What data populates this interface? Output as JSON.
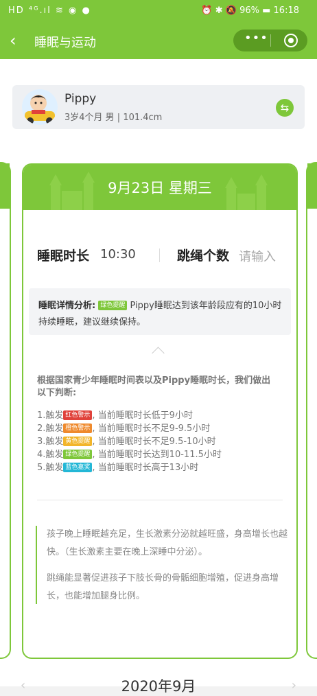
{
  "status_bar": {
    "left": "HD ⁴ᴳ.ıl ≋ ◉ ●",
    "right": "⏰ ✱ 🔕 96% ▬ 16:18"
  },
  "navbar": {
    "back_icon": "‹",
    "title": "睡眠与运动",
    "more_icon": "•••"
  },
  "profile": {
    "name": "Pippy",
    "info": "3岁4个月 男 | 101.4cm",
    "switch_icon": "⇆"
  },
  "card": {
    "date": "9月23日 星期三",
    "sleep_label": "睡眠时长",
    "sleep_value": "10:30",
    "jump_label": "跳绳个数",
    "jump_placeholder": "请输入",
    "analysis_label": "睡眠详情分析:",
    "analysis_tag": "绿色提醒",
    "analysis_text": "Pippy睡眠达到该年龄段应有的10小时持续睡眠，建议继续保持。",
    "rules_title": "根据国家青少年睡眠时间表以及Pippy睡眠时长，我们做出以下判断:",
    "rules": [
      {
        "prefix": "1.触发",
        "tag": "红色警示",
        "color": "red",
        "text": ", 当前睡眠时长低于9小时"
      },
      {
        "prefix": "2.触发",
        "tag": "橙色警示",
        "color": "orange",
        "text": ", 当前睡眠时长不足9-9.5小时"
      },
      {
        "prefix": "3.触发",
        "tag": "黄色提醒",
        "color": "yellow",
        "text": ", 当前睡眠时长不足9.5-10小时"
      },
      {
        "prefix": "4.触发",
        "tag": "绿色提醒",
        "color": "green",
        "text": ", 当前睡眠时长达到10-11.5小时"
      },
      {
        "prefix": "5.触发",
        "tag": "蓝色嘉奖",
        "color": "blue",
        "text": ", 当前睡眠时长高于13小时"
      }
    ],
    "quote_1": "孩子晚上睡眠越充足，生长激素分泌就越旺盛，身高增长也越快。（生长激素主要在晚上深睡中分泌）。",
    "quote_2": "跳绳能显著促进孩子下肢长骨的骨骺细胞增殖，促进身高增长，也能增加腿身比例。"
  },
  "month": {
    "title": "2020年9月",
    "prev_icon": "‹",
    "next_icon": "›"
  },
  "colors": {
    "brand_green": "#7ec73a",
    "red": "#e0423b",
    "orange": "#ef8a2d",
    "yellow": "#f2b52a",
    "blue": "#23b7d6"
  }
}
